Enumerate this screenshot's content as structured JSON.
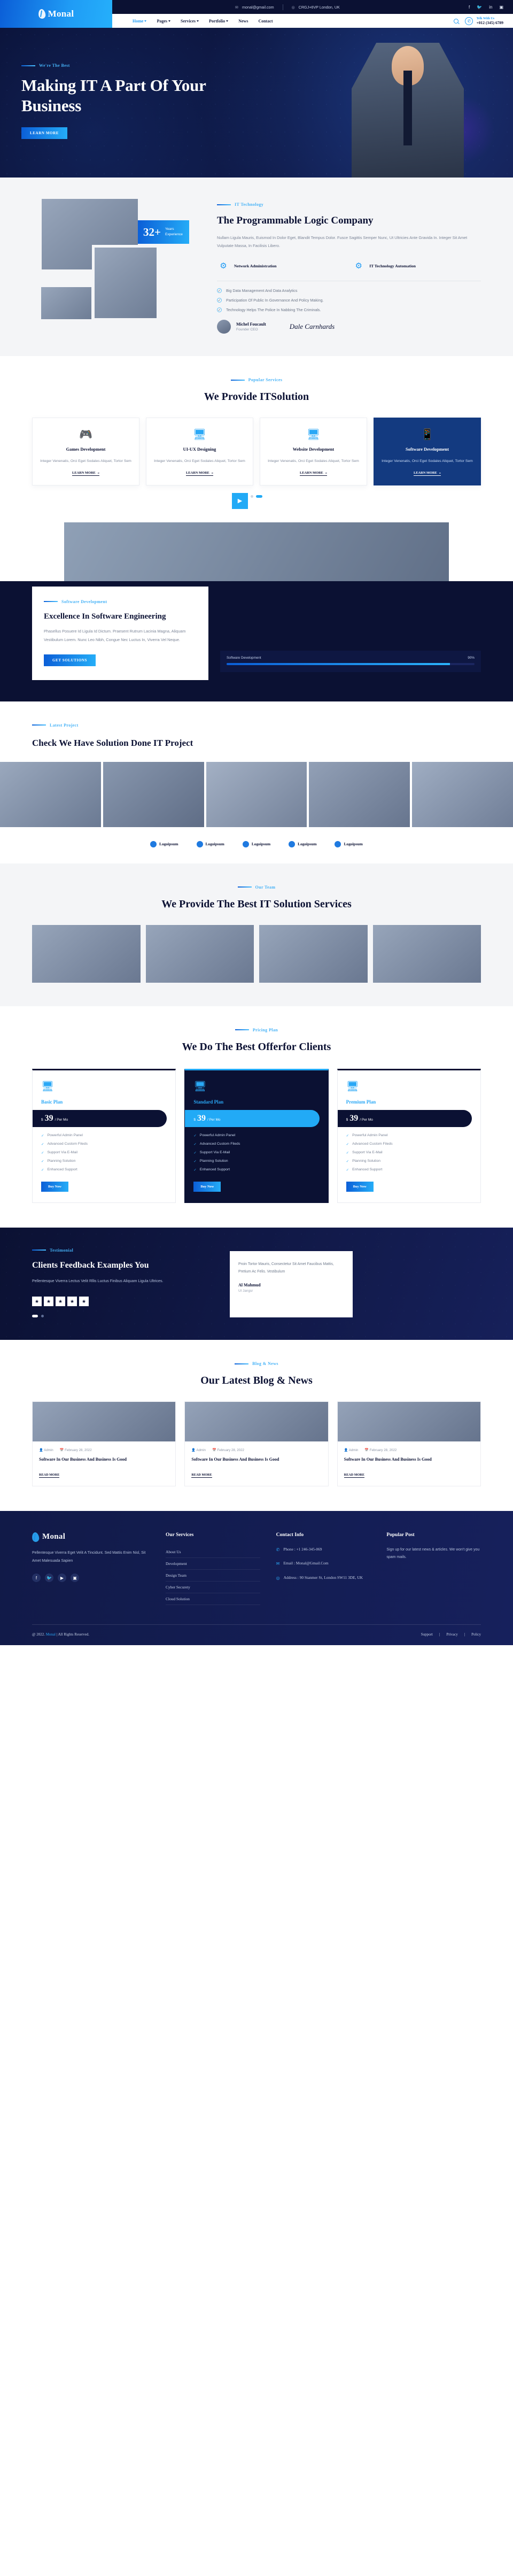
{
  "brand": {
    "name": "Monal",
    "logo_icon": "leaf-shield-icon"
  },
  "topbar": {
    "email": "monal@gmail.com",
    "email_icon": "envelope-icon",
    "address": "CRGJ+6VP London, UK",
    "address_icon": "map-pin-icon",
    "social": [
      {
        "name": "facebook-icon",
        "glyph": "f"
      },
      {
        "name": "twitter-icon",
        "glyph": "🐦"
      },
      {
        "name": "linkedin-icon",
        "glyph": "in"
      },
      {
        "name": "instagram-icon",
        "glyph": "▣"
      }
    ]
  },
  "nav": {
    "items": [
      {
        "label": "Home",
        "has_caret": true,
        "active": true
      },
      {
        "label": "Pages",
        "has_caret": true,
        "active": false
      },
      {
        "label": "Services",
        "has_caret": true,
        "active": false
      },
      {
        "label": "Portfolio",
        "has_caret": true,
        "active": false
      },
      {
        "label": "News",
        "has_caret": false,
        "active": false
      },
      {
        "label": "Contact",
        "has_caret": false,
        "active": false
      }
    ],
    "search_icon": "search-icon",
    "call_icon": "phone-icon",
    "call_label": "Telk With Us",
    "call_number": "+012 (345) 6789"
  },
  "hero": {
    "eyebrow": "We're The Best",
    "title": "Making IT A Part Of Your Business",
    "cta": "LEARN MORE"
  },
  "about": {
    "badge_number": "32+",
    "badge_label": "Years\nExperience",
    "eyebrow": "IT Technology",
    "title": "The Programmable Logic Company",
    "paragraph": "Nullam Ligula Mauris, Euismod In Dolor Eget, Blandit Tempus Dolor. Fusce Sagittis Semper Nunc, Ut Ultricies Ante Gravida In. Integer Sit Amet Vulputate Massa, In Facilisis Libero.",
    "features": [
      {
        "icon": "network-icon",
        "label": "Network Administration"
      },
      {
        "icon": "gears-icon",
        "label": "IT Technology Automation"
      }
    ],
    "checks": [
      "Big Data Management And Data Analytics",
      "Participation Of Public In Governance And Policy Making.",
      "Technology Helps The Police In Nabbing The Criminals."
    ],
    "author_name": "Michel Foucault",
    "author_role": "Founder CEO",
    "signature": "Dale Carnhards"
  },
  "services": {
    "eyebrow": "Popular Services",
    "title": "We Provide ITSolution",
    "cards": [
      {
        "icon": "gamepad-icon",
        "title": "Games Development",
        "text": "Integer Venenatis, Orci Eget Sodales Aliquet, Tortor Sem",
        "link": "LEARN MORE",
        "dark": false
      },
      {
        "icon": "ux-monitor-icon",
        "title": "UI-UX Designing",
        "text": "Integer Venenatis, Orci Eget Sodales Aliquet, Tortor Sem",
        "link": "LEARN MORE",
        "dark": false
      },
      {
        "icon": "code-monitor-icon",
        "title": "Website Development",
        "text": "Integer Venenatis, Orci Eget Sodales Aliquet, Tortor Sem",
        "link": "LEARN MORE",
        "dark": false
      },
      {
        "icon": "mobile-code-icon",
        "title": "Software Development",
        "text": "Integer Venenatis, Orci Eget Sodales Aliquet, Tortor Sem",
        "link": "LEARN MORE",
        "dark": true
      }
    ],
    "next_icon": "play-arrow-icon"
  },
  "excellence": {
    "eyebrow": "Software Development",
    "title": "Excellence In Software Engineering",
    "paragraph": "Phasellus Posuere Id Ligula Id Dictum. Praesent Rutrum Lacinia Magna, Aliquam Vestibulum Lorem. Nunc Leo Nibh, Congue Nec Luctus In, Viverra Vel Neque.",
    "cta": "GET SOLUTIONS",
    "progress_label": "Software Development",
    "progress_value": "90",
    "progress_display": "90%"
  },
  "projects": {
    "eyebrow": "Latest Project",
    "title": "Check We Have Solution Done IT Project",
    "tiles": [
      "project-1",
      "project-2",
      "project-3",
      "project-4",
      "project-5"
    ],
    "logos": [
      "Logoipsum",
      "Logoipsum",
      "Logoipsum",
      "Logoipsum",
      "Logoipsum"
    ]
  },
  "bestit": {
    "eyebrow": "Our Team",
    "title": "We Provide The Best IT Solution Services",
    "tiles": [
      "team-member-1",
      "team-member-2",
      "team-member-3",
      "team-member-4"
    ]
  },
  "pricing": {
    "eyebrow": "Pricing Plan",
    "title": "We Do The Best Offerfor Clients",
    "plans": [
      {
        "icon": "ux-monitor-icon",
        "name": "Basic Plan",
        "currency": "$",
        "amount": "39",
        "period": "/ Per Mo",
        "dark": false,
        "features": [
          "Powerful Admin Panel",
          "Advanced Custom Fileds",
          "Support Via E-Mail",
          "Planning Solution",
          "Enhanced Support"
        ],
        "cta": "Buy Now"
      },
      {
        "icon": "ux-monitor-icon",
        "name": "Standard Plan",
        "currency": "$",
        "amount": "39",
        "period": "/ Per Mo",
        "dark": true,
        "features": [
          "Powerful Admin Panel",
          "Advanced Custom Fileds",
          "Support Via E-Mail",
          "Planning Solution",
          "Enhanced Support"
        ],
        "cta": "Buy Now"
      },
      {
        "icon": "ux-monitor-icon",
        "name": "Premium Plan",
        "currency": "$",
        "amount": "39",
        "period": "/ Per Mo",
        "dark": false,
        "features": [
          "Powerful Admin Panel",
          "Advanced Custom Fileds",
          "Support Via E-Mail",
          "Planning Solution",
          "Enhanced Support"
        ],
        "cta": "Buy Now"
      }
    ]
  },
  "testimonial": {
    "eyebrow": "Testimonial",
    "title": "Clients Feedback Examples You",
    "paragraph": "Pellentesque Viverra Lectus Velit Rllis Luctus Finibus Aliquam Ligula Ultrices.",
    "quote": "Proin Tortor Mauris, Consectetur Sit Amet Faucibus Mattis, Pretium Ac Felis. Vestibulum",
    "quote_name": "Al Mahmud",
    "quote_role": "UI Jangsr",
    "rating_icon": "star-icon",
    "rating_count": "5"
  },
  "blog": {
    "eyebrow": "Blog & News",
    "title": "Our Latest Blog & News",
    "posts": [
      {
        "author": "Admin",
        "date": "February 28, 2022",
        "title": "Software In Our Business And Business Is Good",
        "link": "READ MORE"
      },
      {
        "author": "Admin",
        "date": "February 28, 2022",
        "title": "Software In Our Business And Business Is Good",
        "link": "READ MORE"
      },
      {
        "author": "Admin",
        "date": "February 28, 2022",
        "title": "Software In Our Business And Business Is Good",
        "link": "READ MORE"
      }
    ],
    "author_icon": "user-icon",
    "date_icon": "calendar-icon"
  },
  "footer": {
    "about_text": "Pellentesque Viverra Eget Velit A Tincidunt. Sed Mattis Enim Nisl, Sit Amet Malesuada Sapien",
    "social": [
      {
        "name": "facebook-icon",
        "glyph": "f"
      },
      {
        "name": "twitter-icon",
        "glyph": "🐦"
      },
      {
        "name": "youtube-icon",
        "glyph": "▶"
      },
      {
        "name": "instagram-icon",
        "glyph": "▣"
      }
    ],
    "services_title": "Our Services",
    "services": [
      "About Us",
      "Development",
      "Design Team",
      "Cyber Securety",
      "Cloud Solution"
    ],
    "contact_title": "Contact Info",
    "contact": [
      {
        "icon": "phone-icon",
        "text": "Phone : +1 246-345-069"
      },
      {
        "icon": "envelope-icon",
        "text": "Email : Monal@Gmail.Com"
      },
      {
        "icon": "map-pin-icon",
        "text": "Address : 90 Stanmer St, London SW11 3DE, UK"
      }
    ],
    "popular_title": "Popular Post",
    "popular_text": "Sign up for our latest news & articles. We won't give you spam mails.",
    "copyright_pre": "@ 2022.",
    "copyright_brand": "Monal",
    "copyright_post": "| All Rights Reserved.",
    "bottom_links": [
      "Support",
      "Privacy",
      "Policy"
    ]
  }
}
